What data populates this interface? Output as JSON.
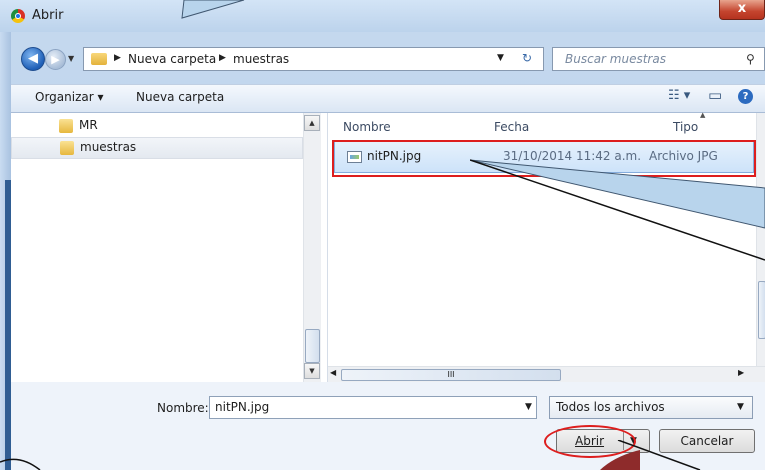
{
  "window": {
    "title": "Abrir",
    "close_glyph": "x",
    "app_icon": "chrome-icon"
  },
  "nav": {
    "back_glyph": "◀",
    "forward_glyph": "▶",
    "dropdown_glyph": "▼",
    "breadcrumb": [
      "Nueva carpeta",
      "muestras"
    ],
    "breadcrumb_sep": "▶",
    "address_dropdown_glyph": "▼",
    "refresh_glyph": "↻",
    "search_placeholder": "Buscar muestras",
    "search_glyph": "⚲"
  },
  "toolbar": {
    "organize_label": "Organizar ▾",
    "new_folder_label": "Nueva carpeta",
    "view_glyph": "☷ ▾",
    "preview_glyph": "▭",
    "help_glyph": "?"
  },
  "tree": {
    "items": [
      {
        "label": "MR",
        "selected": false
      },
      {
        "label": "muestras",
        "selected": true
      }
    ]
  },
  "file_list": {
    "columns": [
      "Nombre",
      "Fecha",
      "Tipo"
    ],
    "rows": [
      {
        "name": "nitPN.jpg",
        "date": "31/10/2014 11:42 a.m.",
        "type": "Archivo JPG"
      }
    ],
    "hscroll_thumb": "III"
  },
  "footer": {
    "name_label": "Nombre:",
    "name_value": "nitPN.jpg",
    "name_dropdown_glyph": "▼",
    "filter_value": "Todos los archivos",
    "filter_dropdown_glyph": "▼",
    "open_label": "Abrir",
    "open_split_glyph": "▼",
    "cancel_label": "Cancelar"
  },
  "colors": {
    "selection_fill": "#cde3fa",
    "annotation_red": "#dd1e1e",
    "callout_fill": "#b8d4ec"
  }
}
